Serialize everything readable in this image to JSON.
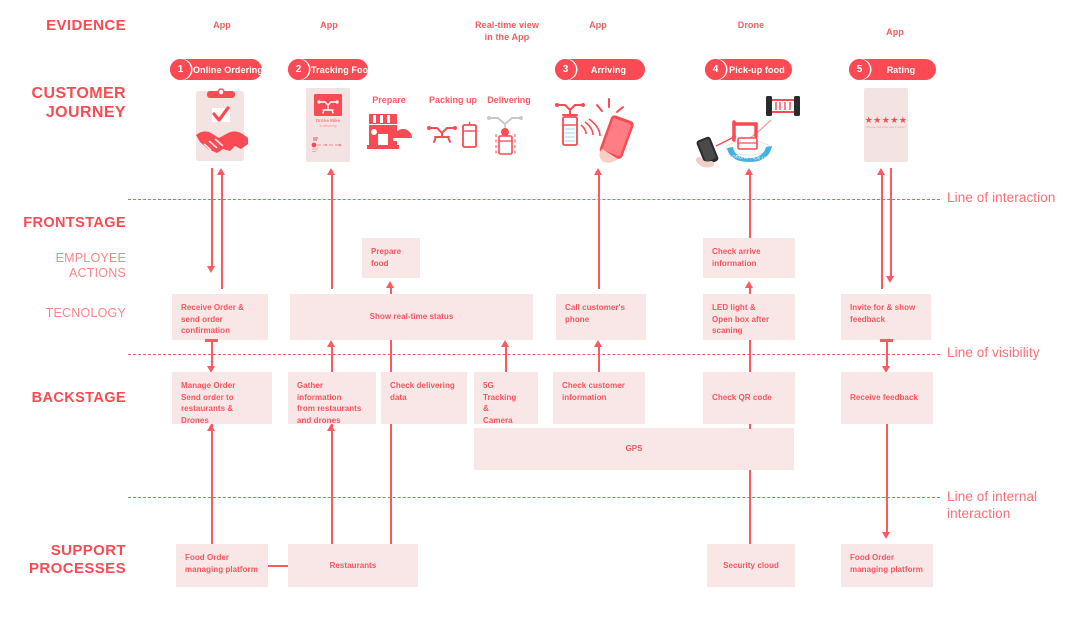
{
  "rails": [
    {
      "text": "EVIDENCE",
      "style": "strong"
    },
    {
      "text": "CUSTOMER\nJOURNEY",
      "style": "strong"
    },
    {
      "text": "FRONTSTAGE",
      "style": "strong"
    },
    {
      "text": "EMPLOYEE\nACTIONS",
      "style": "soft"
    },
    {
      "text": "TECNOLOGY",
      "style": "soft"
    },
    {
      "text": "BACKSTAGE",
      "style": "strong"
    },
    {
      "text": "SUPPORT\nPROCESSES",
      "style": "strong"
    }
  ],
  "evidence": [
    {
      "label": "App"
    },
    {
      "label": "App"
    },
    {
      "label": "Real-time view\nin the App"
    },
    {
      "label": "App"
    },
    {
      "label": "Drone"
    },
    {
      "label": "App"
    }
  ],
  "stages": [
    {
      "num": "1",
      "label": "Online Ordering"
    },
    {
      "num": "2",
      "label": "Tracking Food"
    },
    {
      "num": "3",
      "label": "Arriving"
    },
    {
      "num": "4",
      "label": "Pick-up food"
    },
    {
      "num": "5",
      "label": "Rating"
    }
  ],
  "journey_steps": [
    {
      "label": "Prepare"
    },
    {
      "label": "Packing up"
    },
    {
      "label": "Delivering"
    }
  ],
  "phone_tracking": {
    "title": "Drone Mike",
    "subtitle": "is delivering"
  },
  "phone_rating": {
    "stars": "★★★★★",
    "caption": "Please rate how was it done?"
  },
  "employee_actions": [
    {
      "text": "Prepare\nfood"
    },
    {
      "text": "Check arrive\ninformation"
    }
  ],
  "technology": [
    {
      "text": "Receive Order &\nsend order\nconfirmation"
    },
    {
      "text": "Show real-time status"
    },
    {
      "text": "Call customer's\nphone"
    },
    {
      "text": "LED light &\nOpen box after\nscaning"
    },
    {
      "text": "Invite for & show\nfeedback"
    }
  ],
  "backstage": [
    {
      "text": "Manage Order\nSend order to\nrestaurants & Drones"
    },
    {
      "text": "Gather information\nfrom restaurants\nand drones"
    },
    {
      "text": "Check delivering\ndata"
    },
    {
      "text": "5G Tracking\n&\nCamera"
    },
    {
      "text": "Check customer\ninformation"
    },
    {
      "text": "Check QR code"
    },
    {
      "text": "Receive feedback"
    },
    {
      "text": "GPS"
    }
  ],
  "support": [
    {
      "text": "Food Order\nmanaging platform"
    },
    {
      "text": "Restaurants"
    },
    {
      "text": "Security cloud"
    },
    {
      "text": "Food Order\nmanaging platform"
    }
  ],
  "lines": [
    {
      "label": "Line of interaction"
    },
    {
      "label": "Line of visibility"
    },
    {
      "label": "Line of internal\ninteraction"
    }
  ],
  "colors": {
    "accent": "#fa4a53",
    "accent_light": "#fb6f76",
    "box_fill": "#f9e7e7",
    "phone_fill": "#f4e3e3",
    "background": "#ffffff"
  }
}
